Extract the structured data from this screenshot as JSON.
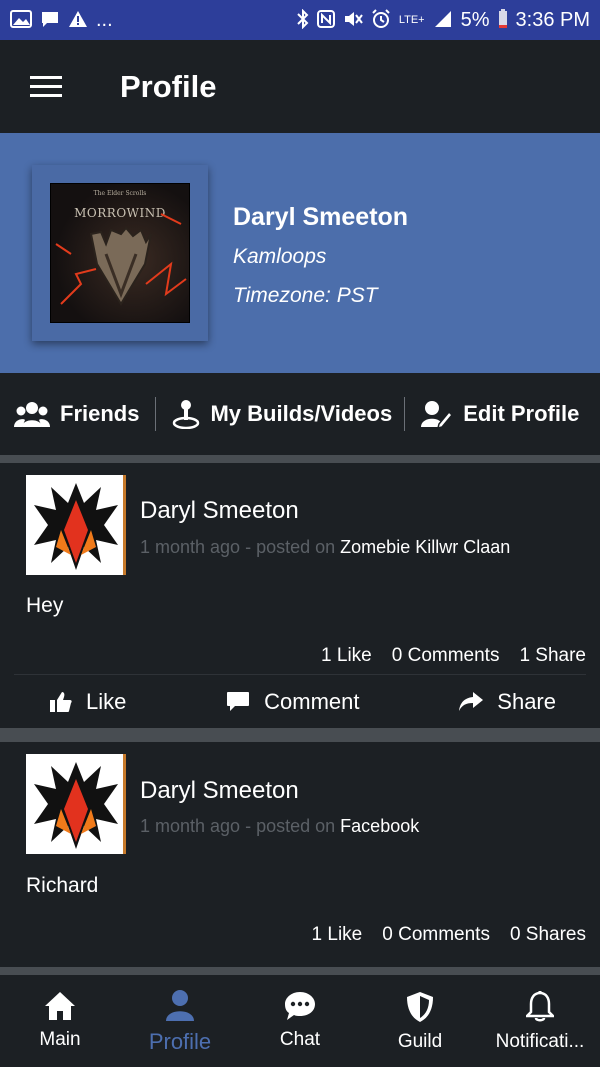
{
  "status_bar": {
    "battery": "5%",
    "time": "3:36 PM",
    "dots": "...",
    "network": "LTE+"
  },
  "app_bar": {
    "title": "Profile"
  },
  "profile": {
    "name": "Daryl Smeeton",
    "city": "Kamloops",
    "timezone": "Timezone: PST",
    "avatar_title": "MORROWIND",
    "avatar_subtitle": "The Elder Scrolls"
  },
  "actions": {
    "friends": "Friends",
    "builds": "My Builds/Videos",
    "edit": "Edit Profile"
  },
  "posts": [
    {
      "author": "Daryl Smeeton",
      "time": "1 month ago",
      "posted_on": "- posted on",
      "group": "Zomebie Killwr Claan",
      "body": "Hey",
      "likes": "1 Like",
      "comments": "0 Comments",
      "shares": "1 Share",
      "like_label": "Like",
      "comment_label": "Comment",
      "share_label": "Share"
    },
    {
      "author": "Daryl Smeeton",
      "time": "1 month ago",
      "posted_on": "- posted on",
      "group": "Facebook",
      "body": "Richard",
      "likes": "1 Like",
      "comments": "0 Comments",
      "shares": "0 Shares"
    }
  ],
  "bottom_nav": [
    {
      "label": "Main",
      "icon": "home-icon"
    },
    {
      "label": "Profile",
      "icon": "person-icon",
      "active": true
    },
    {
      "label": "Chat",
      "icon": "chat-icon"
    },
    {
      "label": "Guild",
      "icon": "shield-icon"
    },
    {
      "label": "Notificati...",
      "icon": "bell-icon"
    }
  ],
  "colors": {
    "status_bar": "#2d3e9a",
    "header": "#4c6eab",
    "background": "#1c2024",
    "active_nav": "#4d6fb0"
  }
}
